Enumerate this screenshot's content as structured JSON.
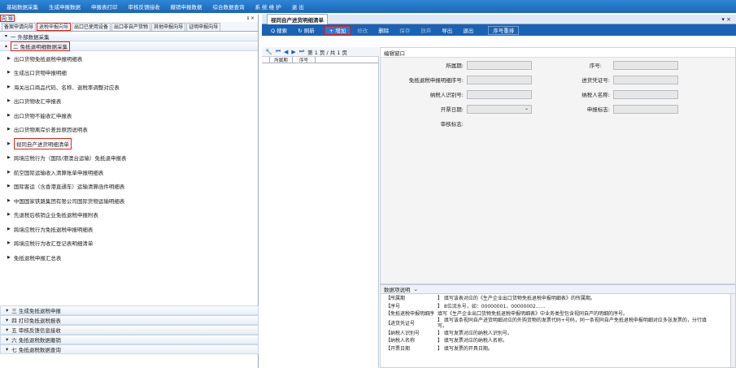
{
  "menubar": [
    "基础数据采集",
    "生成申报数据",
    "申报表打印",
    "审核反馈接收",
    "撤销申报数据",
    "综合数据查询",
    "系 统 维 护",
    "退 出"
  ],
  "left": {
    "title": "向 导",
    "pin": "ᵻ ×",
    "tabs": [
      "备案申请向导",
      "退税申报向导",
      "出口已使用设备",
      "出口非自产货物",
      "其他申报向导",
      "证明申报向导"
    ],
    "section1": "一 外部数据采集",
    "section2": "二 免抵退明细数据采集",
    "items": [
      "出口货物免抵退税申报明细表",
      "生成出口货物申报明细",
      "海关出口商品代码、名称、退税率调整对应表",
      "出口货物收汇申报表",
      "出口货物不能收汇申报表",
      "出口货物离岸价差异原因说明表",
      "视同自产进货明细清单",
      "跨境应税行为（国际/港澳台运输）免抵退申报表",
      "航空国际运输收入清算账单申报明细表",
      "国际客运（含香港直通车）运输清算函件明细表",
      "中国国家铁路集团有限公司国际货物运输明细表",
      "先退税后核销企业免抵退税申报附表",
      "跨境应税行为免抵退税申报明细表",
      "跨境应税行为收汇登记表明细清单",
      "免抵退税申报汇总表"
    ],
    "lower": [
      "三 生成免抵退税申报",
      "四 打印免抵退税报表",
      "五 审核反馈信息接收",
      "六 免抵退税数据撤销",
      "七 免抵退税数据查询"
    ]
  },
  "right": {
    "tab": "视同自产进货明细清单",
    "toolbar": {
      "search": "Q 搜索",
      "refresh": "↻ 刷新",
      "add": "+ 增加",
      "modify": "修改",
      "delete": "删除",
      "save": "保存",
      "cancel": "放弃",
      "import": "导出",
      "exit": "退出",
      "seq": "序号重排"
    },
    "pager": {
      "text": "第 1 页 / 共 1 页"
    },
    "grid_headers": [
      "所属期",
      "序号"
    ],
    "edit_title": "编辑窗口",
    "fields": {
      "f1": "所属期:",
      "f2": "序号:",
      "f3": "免抵退税申报明细序号:",
      "f4": "进货凭证号:",
      "f5": "纳税人识别号:",
      "f6": "纳税人名称:",
      "f7": "开票日期:",
      "f8": "申报标志:",
      "f9": "审核标志:"
    },
    "desc_title": "数据项说明",
    "desc": [
      {
        "k": "【所属期",
        "v": "】 填写该表对应的《生产企业出口货物免抵退税申报明细表》的所属期。"
      },
      {
        "k": "【序号",
        "v": "】 8位流水号，如：00000001，00000002……"
      },
      {
        "k": "【免抵退税申报明细序",
        "v": "填写《生产企业出口货物免抵退税申报明细表》中业务类型包含视同自产的明细的序号。"
      },
      {
        "k": "【进货凭证号",
        "v": "】 填写该条视同自产进货明细对应的外购货物的发票代码+号码，同一条视同自产免抵退税申报明细对应多张发票的，分行填写。"
      },
      {
        "k": "【纳税人识别号",
        "v": "】 填写发票对应的纳税人识别号。"
      },
      {
        "k": "【纳税人名称",
        "v": "】 填写发票对应的纳税人名称。"
      },
      {
        "k": "【开票日期",
        "v": "】 填写发票的开具日期。"
      }
    ]
  }
}
